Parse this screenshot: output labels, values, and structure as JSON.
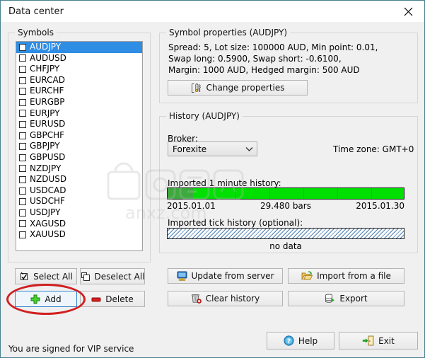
{
  "window": {
    "title": "Data center",
    "close_icon": "close-icon"
  },
  "symbols_group": {
    "legend": "Symbols",
    "items": [
      {
        "label": "AUDJPY",
        "checked": false,
        "selected": true
      },
      {
        "label": "AUDUSD",
        "checked": false,
        "selected": false
      },
      {
        "label": "CHFJPY",
        "checked": false,
        "selected": false
      },
      {
        "label": "EURCAD",
        "checked": false,
        "selected": false
      },
      {
        "label": "EURCHF",
        "checked": false,
        "selected": false
      },
      {
        "label": "EURGBP",
        "checked": false,
        "selected": false
      },
      {
        "label": "EURJPY",
        "checked": false,
        "selected": false
      },
      {
        "label": "EURUSD",
        "checked": false,
        "selected": false
      },
      {
        "label": "GBPCHF",
        "checked": false,
        "selected": false
      },
      {
        "label": "GBPJPY",
        "checked": false,
        "selected": false
      },
      {
        "label": "GBPUSD",
        "checked": false,
        "selected": false
      },
      {
        "label": "NZDJPY",
        "checked": false,
        "selected": false
      },
      {
        "label": "NZDUSD",
        "checked": false,
        "selected": false
      },
      {
        "label": "USDCAD",
        "checked": false,
        "selected": false
      },
      {
        "label": "USDCHF",
        "checked": false,
        "selected": false
      },
      {
        "label": "USDJPY",
        "checked": false,
        "selected": false
      },
      {
        "label": "XAGUSD",
        "checked": false,
        "selected": false
      },
      {
        "label": "XAUUSD",
        "checked": false,
        "selected": false
      }
    ],
    "buttons": {
      "select_all": "Select All",
      "deselect_all": "Deselect All",
      "add": "Add",
      "delete": "Delete"
    },
    "icons": {
      "select_all": "checkbox-checked-icon",
      "deselect_all": "checkbox-empty-icon",
      "add": "plus-icon",
      "delete": "minus-bar-icon"
    }
  },
  "properties_group": {
    "legend": "Symbol properties (AUDJPY)",
    "line1": "Spread: 5, Lot size: 100000 AUD, Min point: 0.01,",
    "line2": "Swap long: 0.5900, Swap short: -0.6100,",
    "line3": "Margin: 1000 AUD, Hedged margin: 500 AUD",
    "change_button": "Change properties",
    "change_icon": "wrench-icon"
  },
  "history_group": {
    "legend": "History (AUDJPY)",
    "broker_label": "Broker:",
    "broker_value": "Forexite",
    "broker_chevron": "chevron-down-icon",
    "timezone": "Time zone: GMT+0",
    "minute_history_label": "Imported 1 minute history:",
    "range_start": "2015.01.01",
    "bars_count": "29.480 bars",
    "range_end": "2015.01.30",
    "tick_history_label": "Imported tick history (optional):",
    "tick_status": "no data",
    "buttons": {
      "update": "Update from server",
      "import": "Import from a file",
      "clear": "Clear history",
      "export": "Export"
    },
    "icons": {
      "update": "monitor-icon",
      "import": "folder-open-icon",
      "clear": "trash-icon",
      "export": "database-export-icon"
    }
  },
  "footer": {
    "status": "You are signed for VIP service",
    "help": "Help",
    "exit": "Exit",
    "help_icon": "question-mark-icon",
    "exit_icon": "door-exit-icon"
  },
  "colors": {
    "selection": "#2f8de4",
    "progress_green": "#00e000",
    "annotation_red": "#d21f1f",
    "window_border": "#4a7f8e"
  }
}
